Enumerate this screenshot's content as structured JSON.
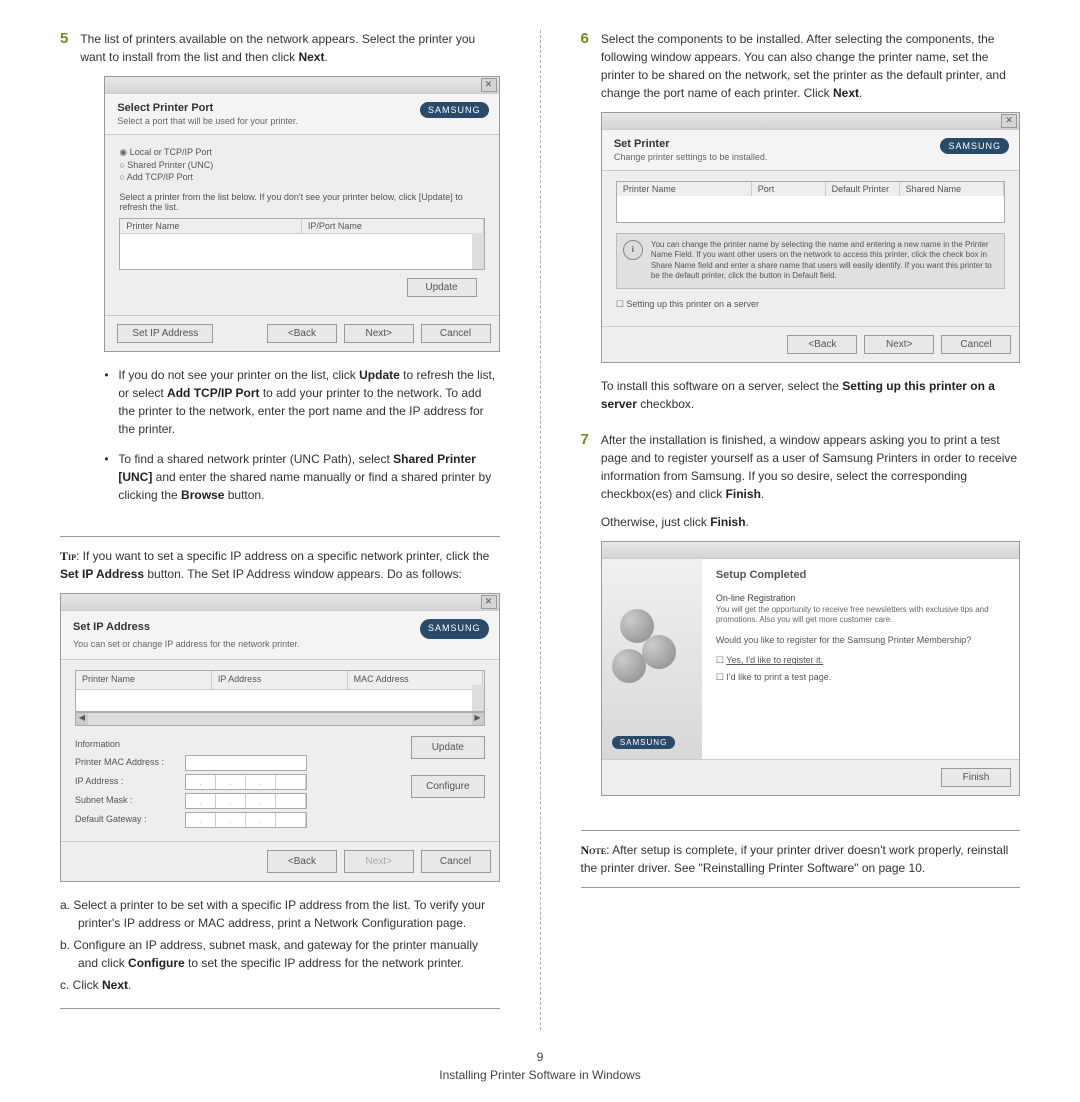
{
  "step5": {
    "num": "5",
    "text": "The list of printers available on the network appears. Select the printer you want to install from the list and then click ",
    "next": "Next",
    "dot": "."
  },
  "dlg1": {
    "title": "Select Printer Port",
    "sub": "Select a port that will be used for your printer.",
    "logo": "SAMSUNG",
    "r1": "Local or TCP/IP Port",
    "r2": "Shared Printer (UNC)",
    "r3": "Add TCP/IP Port",
    "hint": "Select a printer from the list below. If you don't see your printer below, click [Update] to refresh the list.",
    "col1": "Printer Name",
    "col2": "IP/Port Name",
    "update": "Update",
    "setip": "Set IP Address",
    "back": "<Back",
    "nextb": "Next>",
    "cancel": "Cancel",
    "close": "✕"
  },
  "bul1": {
    "t1": "If you do not see your printer on the list, click ",
    "b1": "Update",
    "t2": " to refresh the list, or select ",
    "b2": "Add TCP/IP Port",
    "t3": " to add your printer to the network. To add the printer to the network, enter the port name and the IP address for the printer."
  },
  "bul2": {
    "t1": "To find a shared network printer (UNC Path), select ",
    "b1": "Shared Printer [UNC]",
    "t2": " and enter the shared name manually or find a shared printer by clicking the ",
    "b2": "Browse",
    "t3": " button."
  },
  "tip": {
    "lead": "Tip",
    "t1": ": If you want to set a specific IP address on a specific network printer, click the ",
    "b1": "Set IP Address",
    "t2": " button. The Set IP Address window appears. Do as follows:"
  },
  "dlg2": {
    "title": "Set IP Address",
    "sub": "You can set or change IP address for the network printer.",
    "c1": "Printer Name",
    "c2": "IP Address",
    "c3": "MAC Address",
    "info": "Information",
    "mac": "Printer MAC Address :",
    "ip": "IP Address :",
    "mask": "Subnet Mask :",
    "gw": "Default Gateway :",
    "update": "Update",
    "configure": "Configure",
    "back": "<Back",
    "next": "Next>",
    "cancel": "Cancel"
  },
  "letters": {
    "a": "a. Select a printer to be set with a specific IP address from the list. To verify your printer's IP address or MAC address, print a Network Configuration page.",
    "b1": "b. Configure an IP address, subnet mask, and gateway for the printer manually and click ",
    "bb": "Configure",
    "b2": " to set the specific IP address for the network printer.",
    "c1": "c. Click ",
    "cb": "Next",
    "c2": "."
  },
  "step6": {
    "num": "6",
    "t1": "Select the components to be installed. After selecting the components, the following window appears. You can also change the printer name, set the printer to be shared on the network, set the printer as the default printer, and change the port name of each printer. Click ",
    "b": "Next",
    "t2": "."
  },
  "dlg3": {
    "title": "Set Printer",
    "sub": "Change printer settings to be installed.",
    "c1": "Printer Name",
    "c2": "Port",
    "c3": "Default Printer",
    "c4": "Shared Name",
    "info": "You can change the printer name by selecting the name and entering a new name in the Printer Name Field. If you want other users on the network to access this printer, click the check box in Share Name field and enter a share name that users will easily identify. If you want this printer to be the default printer, click the button in Default field.",
    "chk": "Setting up this printer on a server",
    "back": "<Back",
    "next": "Next>",
    "cancel": "Cancel"
  },
  "post6": {
    "t1": "To install this software on a server, select the ",
    "b": "Setting up this printer on a server",
    "t2": " checkbox."
  },
  "step7": {
    "num": "7",
    "t1": "After the installation is finished, a window appears asking you to print a test page and to register yourself as a user of Samsung Printers in order to receive information from Samsung. If you so desire, select the corresponding checkbox(es) and click ",
    "b": "Finish",
    "t2": ".",
    "t3": "Otherwise, just click ",
    "b2": "Finish",
    "t4": "."
  },
  "dlg4": {
    "title": "Setup Completed",
    "sub": "On-line Registration",
    "txt": "You will get the opportunity to receive free newsletters with exclusive tips and promotions. Also you will get more customer care.",
    "q": "Would you like to register for the Samsung Printer Membership?",
    "c1": "Yes, I'd like to register it.",
    "c2": "I'd like to print a test page.",
    "finish": "Finish",
    "logo": "SAMSUNG"
  },
  "note": {
    "lead": "Note",
    "t1": ": After setup is complete, if your printer driver doesn't work properly, reinstall the printer driver. See \"Reinstalling Printer Software\" on page 10."
  },
  "footer": {
    "num": "9",
    "title": "Installing Printer Software in Windows"
  }
}
